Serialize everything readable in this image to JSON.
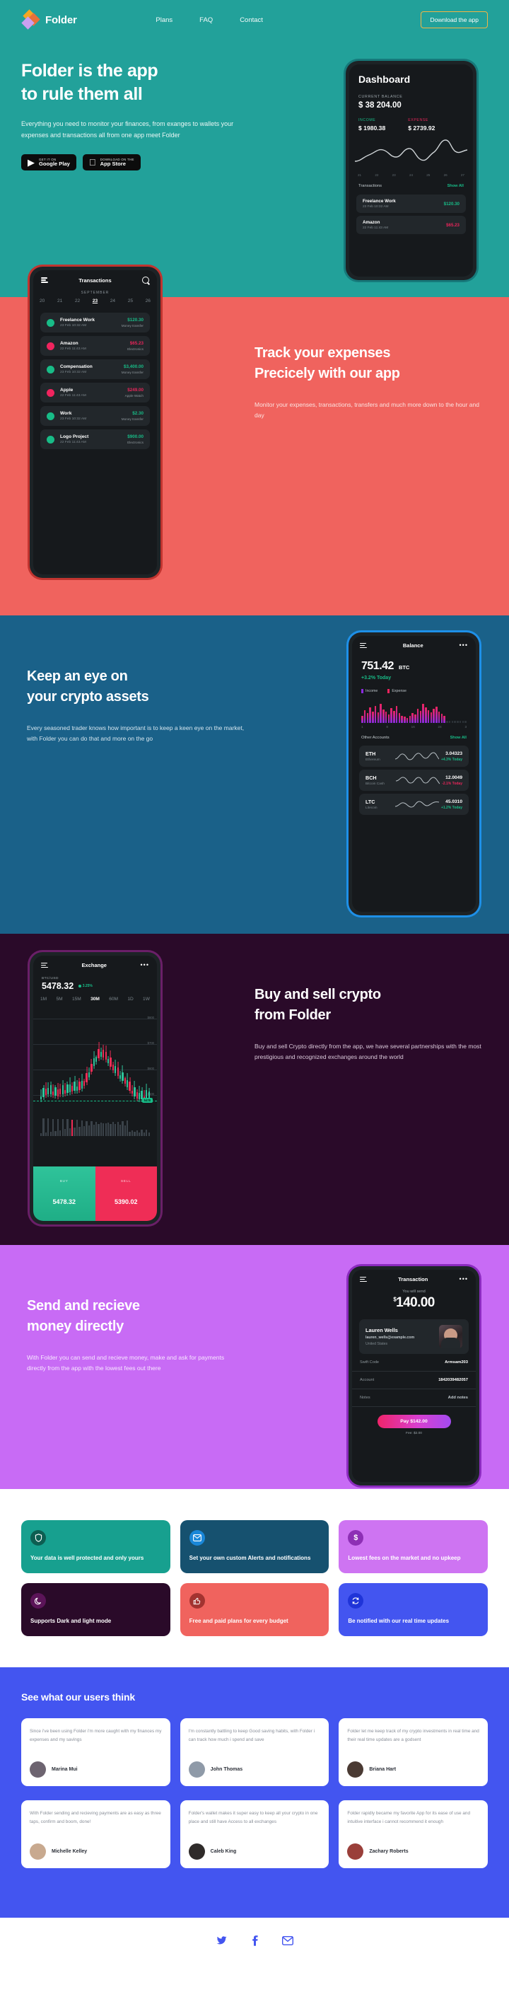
{
  "brand": {
    "name": "Folder",
    "logo_icon": "folder-logo-icon"
  },
  "nav": {
    "links": [
      {
        "label": "Plans"
      },
      {
        "label": "FAQ"
      },
      {
        "label": "Contact"
      }
    ],
    "cta": "Download the app"
  },
  "hero": {
    "heading_line1": "Folder is the app",
    "heading_line2": "to rule them all",
    "paragraph": "Everything you need to monitor your finances, from exanges to wallets your expenses and transactions all from one app meet Folder",
    "stores": [
      {
        "small": "GET IT ON",
        "big": "Google Play",
        "icon": "google-play-icon"
      },
      {
        "small": "Download on the",
        "big": "App Store",
        "icon": "apple-icon"
      }
    ],
    "phone": {
      "title": "Dashboard",
      "balance_label": "CURRENT BALANCE",
      "balance": "$ 38 204.00",
      "income_label": "INCOME",
      "income": "$ 1980.38",
      "expense_label": "EXPENSE",
      "expense": "$ 2739.92",
      "axis": [
        "21",
        "22",
        "23",
        "24",
        "25",
        "26",
        "27"
      ],
      "transactions_label": "Transactions",
      "show_all": "Show All",
      "transactions": [
        {
          "name": "Freelance Work",
          "date": "23 Feb 10:32 AM",
          "amount": "$120.30",
          "sign": "pos"
        },
        {
          "name": "Amazon",
          "date": "22 Feb 11:43 AM",
          "amount": "$65.23",
          "sign": "neg"
        }
      ]
    }
  },
  "expenses": {
    "heading_line1": "Track your expenses",
    "heading_line2": "Precicely with our app",
    "paragraph": "Monitor your expenses, transactions, transfers and much more down to the hour and day",
    "phone": {
      "title": "Transactions",
      "month": "SEPTEMBER",
      "days": [
        "20",
        "21",
        "22",
        "23",
        "24",
        "25",
        "26"
      ],
      "active_day": "23",
      "transactions": [
        {
          "name": "Freelance Work",
          "date": "23 Feb 10:32 AM",
          "amount": "$120.30",
          "category": "Money transfer",
          "sign": "pos"
        },
        {
          "name": "Amazon",
          "date": "22 Feb 11:43 AM",
          "amount": "$65.23",
          "category": "Electronics",
          "sign": "neg"
        },
        {
          "name": "Compensation",
          "date": "23 Feb 10:32 AM",
          "amount": "$3,400.00",
          "category": "Money transfer",
          "sign": "pos"
        },
        {
          "name": "Apple",
          "date": "22 Feb 11:43 AM",
          "amount": "$249.00",
          "category": "Apple Watch",
          "sign": "neg"
        },
        {
          "name": "Work",
          "date": "23 Feb 10:32 AM",
          "amount": "$2.30",
          "category": "Money transfer",
          "sign": "pos"
        },
        {
          "name": "Logo Project",
          "date": "22 Feb 11:43 AM",
          "amount": "$900.00",
          "category": "Electronics",
          "sign": "pos"
        }
      ]
    }
  },
  "crypto": {
    "heading_line1": "Keep an eye on",
    "heading_line2": "your crypto assets",
    "paragraph": "Every seasoned trader knows how important is to keep a keen eye on the market, with Folder you can do that and more on the go",
    "phone": {
      "title": "Balance",
      "balance": "751.42",
      "currency": "BTC",
      "change": "+3.2% Today",
      "legend": [
        {
          "label": "Income"
        },
        {
          "label": "Expense"
        }
      ],
      "axis": [
        "1",
        "8",
        "16",
        "24",
        "3"
      ],
      "other_accounts_label": "Other Accounts",
      "show_all": "Show All",
      "coins": [
        {
          "symbol": "ETH",
          "name": "Ethereum",
          "value": "3.04323",
          "change": "+4.3% Today",
          "dir": "up"
        },
        {
          "symbol": "BCH",
          "name": "Bitcoin Cash",
          "value": "12.0049",
          "change": "-2.1% Today",
          "dir": "down"
        },
        {
          "symbol": "LTC",
          "name": "Litecoin",
          "value": "45.0310",
          "change": "+1.2% Today",
          "dir": "up"
        }
      ]
    }
  },
  "exchange": {
    "heading_line1": "Buy and sell crypto",
    "heading_line2": "from Folder",
    "paragraph": "Buy and sell Crypto directly from the app, we have several partnerships with the most prestigious and recognized exchanges around the world",
    "phone": {
      "title": "Exchange",
      "pair": "BTC/USD",
      "price": "5478.32",
      "change": "3.25%",
      "timeframes": [
        "1M",
        "5M",
        "15M",
        "30M",
        "60M",
        "1D",
        "1W"
      ],
      "active_timeframe": "30M",
      "y_labels": [
        "$800",
        "$700",
        "$600",
        "$500",
        "$100"
      ],
      "current_price_tag": "5478",
      "buy_label": "BUY",
      "buy_price": "5478.32",
      "sell_label": "SELL",
      "sell_price": "5390.02"
    }
  },
  "send": {
    "heading_line1": "Send and recieve",
    "heading_line2": "money directly",
    "paragraph": "With Folder you can send and recieve money, make and ask for payments directly from the app with the lowest fees out there",
    "phone": {
      "title": "Transaction",
      "you_will_send": "You will send",
      "amount": "140.00",
      "currency_sign": "$",
      "recipient_name": "Lauren Wells",
      "recipient_email": "lauren_wells@example.com",
      "recipient_country": "United States",
      "rows": [
        {
          "key": "Swift Code",
          "value": "Armsam203"
        },
        {
          "key": "Account",
          "value": "1842039482057"
        },
        {
          "key": "Notes",
          "value": "Add notes"
        }
      ],
      "pay_button": "Pay $142.00",
      "fee": "Fee: $2.00"
    }
  },
  "features": [
    {
      "text": "Your data is well protected and only yours",
      "bg": "#17A08F",
      "icon": "shield-icon",
      "icon_bg": "#0D5E52"
    },
    {
      "text": "Set your own custom Alerts and notifications",
      "bg": "#16516F",
      "icon": "mail-icon",
      "icon_bg": "#1A87D8"
    },
    {
      "text": "Lowest fees on the market and no upkeep",
      "bg": "#CE74F2",
      "icon": "dollar-icon",
      "icon_bg": "#8D2FB5"
    },
    {
      "text": "Supports Dark and light mode",
      "bg": "#2A0A29",
      "icon": "moon-icon",
      "icon_bg": "#5B1458"
    },
    {
      "text": "Free and paid plans for every budget",
      "bg": "#F0635E",
      "icon": "thumbs-up-icon",
      "icon_bg": "#A33330"
    },
    {
      "text": "Be notified with our real time updates",
      "bg": "#4355F0",
      "icon": "refresh-icon",
      "icon_bg": "#1F34D8"
    }
  ],
  "testimonials": {
    "heading": "See what our users think",
    "items": [
      {
        "quote": "Since i've been using Folder i'm more caught with my finances my expenses and my savings",
        "name": "Marina Mui",
        "av1": "#b9a59d",
        "av2": "#6d6470"
      },
      {
        "quote": "I'm constantly battling to keep Good saving habits, with Folder i can track how much i spend and save",
        "name": "John Thomas",
        "av1": "#d8b79c",
        "av2": "#3a3f4a"
      },
      {
        "quote": "Folder let me keep track of my crypto investments in real time and their real time updates are a godsent",
        "name": "Briana Hart",
        "av1": "#e0b89d",
        "av2": "#4a3a33"
      },
      {
        "quote": "With Folder sending and recieving payments are as easy as three taps, confirm and boom, done!",
        "name": "Michelle Kelley",
        "av1": "#e3bda4",
        "av2": "#c8a98f"
      },
      {
        "quote": "Folder's wallet makes it super easy to keep all your crypto in one place and still have Access to all exchanges",
        "name": "Caleb King",
        "av1": "#d7ab8d",
        "av2": "#2f2b2a"
      },
      {
        "quote": "Folder rapidly became my favorite App for its ease of use and intuitive interface i cannot recommend it enough",
        "name": "Zachary Roberts",
        "av1": "#d8a88a",
        "av2": "#9a3f3a"
      }
    ]
  },
  "footer": {
    "socials": [
      {
        "icon": "twitter-icon",
        "glyph": "ᵑ"
      },
      {
        "icon": "facebook-icon",
        "glyph": "f"
      },
      {
        "icon": "email-icon",
        "glyph": "✉"
      }
    ]
  },
  "colors": {
    "teal": "#22A19A",
    "coral": "#F0635E",
    "blue": "#1A6189",
    "plum": "#2A0A29",
    "violet": "#C86BF5",
    "indigo": "#4355F0",
    "green": "#18BC87",
    "red": "#E8255A",
    "amber": "#F3B544"
  }
}
